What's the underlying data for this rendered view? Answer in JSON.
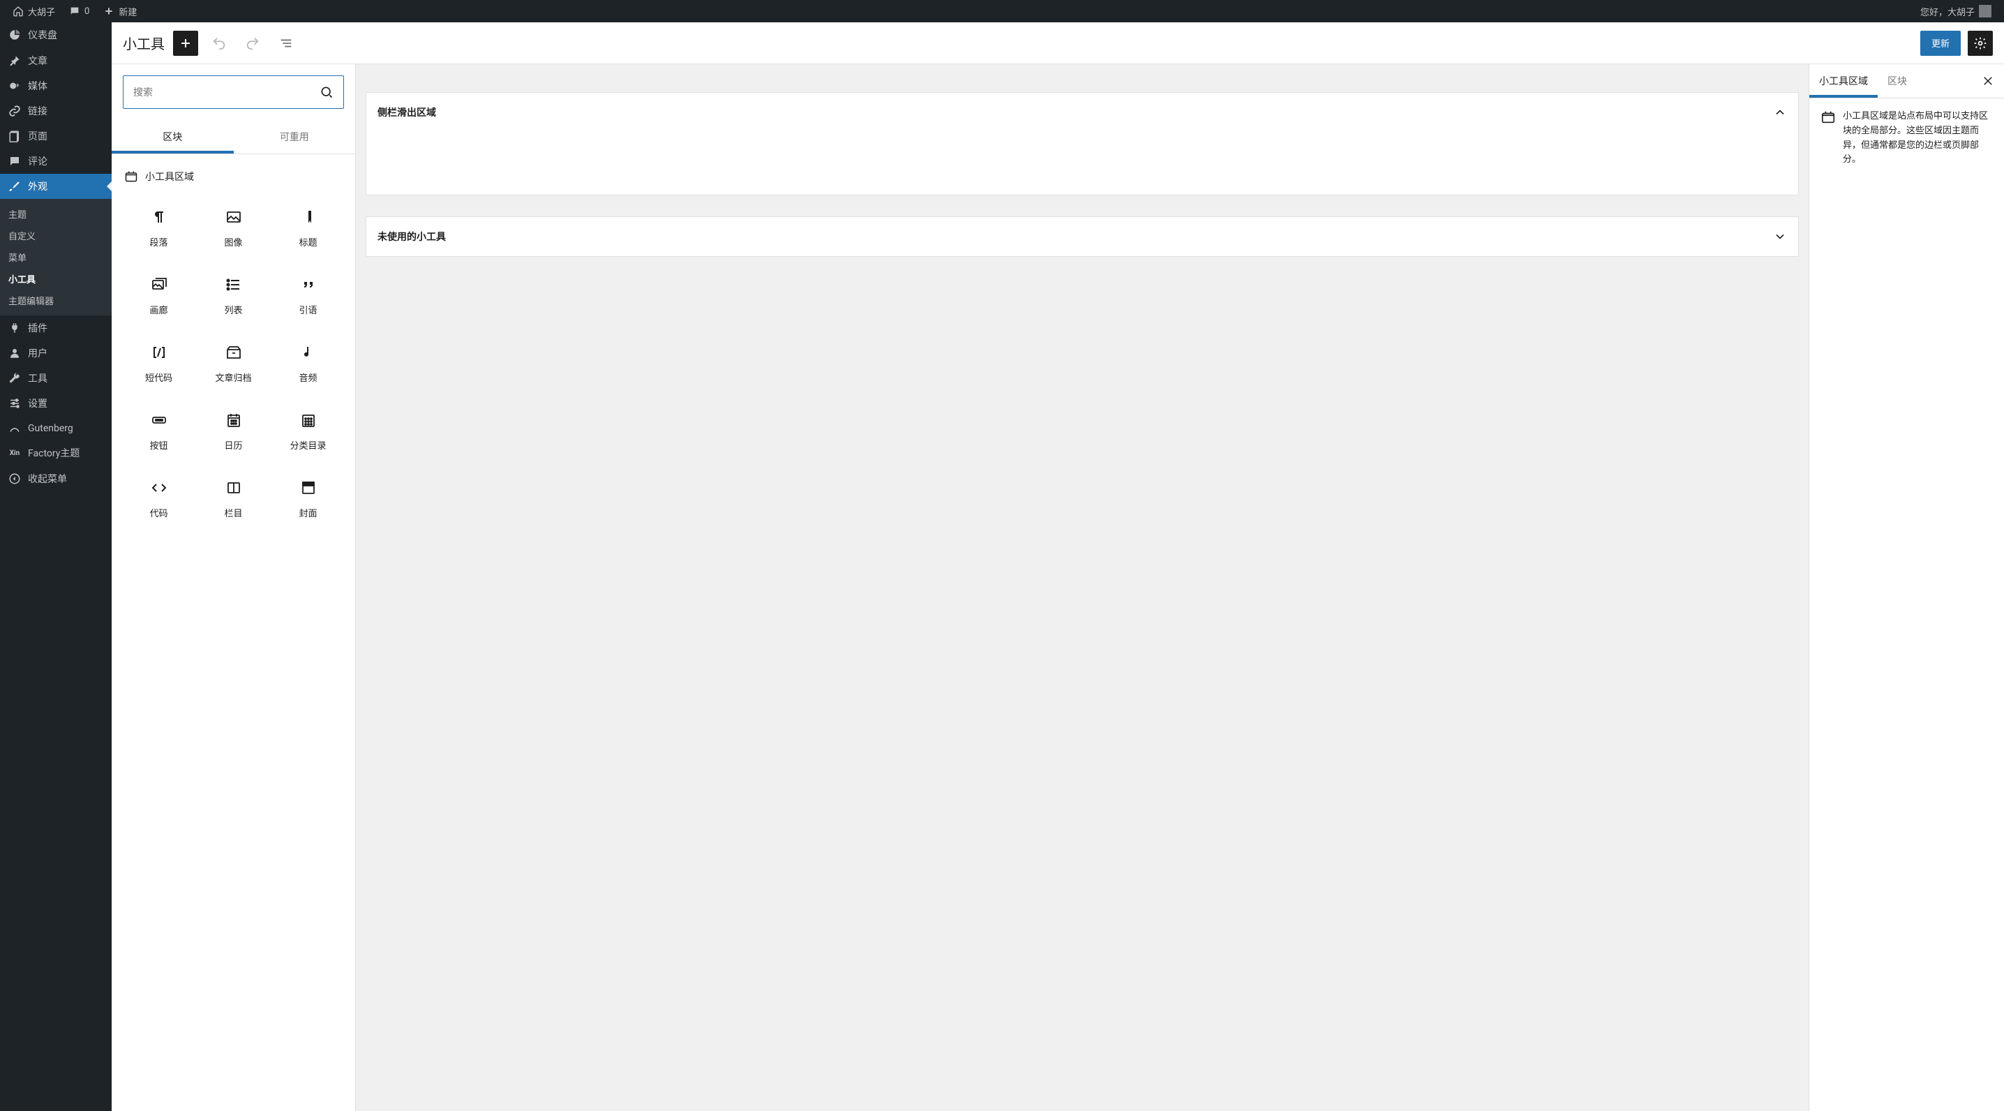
{
  "adminbar": {
    "site_name": "大胡子",
    "comments_count": "0",
    "new_label": "新建",
    "greeting": "您好，大胡子"
  },
  "sidebar": {
    "items": [
      {
        "id": "dashboard",
        "label": "仪表盘",
        "icon": "dashboard"
      },
      {
        "id": "posts",
        "label": "文章",
        "icon": "pin"
      },
      {
        "id": "media",
        "label": "媒体",
        "icon": "media"
      },
      {
        "id": "links",
        "label": "链接",
        "icon": "link"
      },
      {
        "id": "pages",
        "label": "页面",
        "icon": "page"
      },
      {
        "id": "comments",
        "label": "评论",
        "icon": "comment"
      },
      {
        "id": "appearance",
        "label": "外观",
        "icon": "brush"
      },
      {
        "id": "plugins",
        "label": "插件",
        "icon": "plug"
      },
      {
        "id": "users",
        "label": "用户",
        "icon": "user"
      },
      {
        "id": "tools",
        "label": "工具",
        "icon": "wrench"
      },
      {
        "id": "settings",
        "label": "设置",
        "icon": "sliders"
      },
      {
        "id": "gutenberg",
        "label": "Gutenberg",
        "icon": "gutenberg"
      },
      {
        "id": "factory",
        "label": "Factory主题",
        "icon": "xin"
      },
      {
        "id": "collapse",
        "label": "收起菜单",
        "icon": "collapse"
      }
    ],
    "appearance_sub": [
      {
        "id": "themes",
        "label": "主题"
      },
      {
        "id": "customize",
        "label": "自定义"
      },
      {
        "id": "menus",
        "label": "菜单"
      },
      {
        "id": "widgets",
        "label": "小工具"
      },
      {
        "id": "editor",
        "label": "主题编辑器"
      }
    ]
  },
  "header": {
    "title": "小工具",
    "update_label": "更新"
  },
  "inserter": {
    "search_placeholder": "搜索",
    "tabs": {
      "blocks": "区块",
      "reusable": "可重用"
    },
    "section_label": "小工具区域",
    "blocks": [
      {
        "id": "paragraph",
        "label": "段落"
      },
      {
        "id": "image",
        "label": "图像"
      },
      {
        "id": "heading",
        "label": "标题"
      },
      {
        "id": "gallery",
        "label": "画廊"
      },
      {
        "id": "list",
        "label": "列表"
      },
      {
        "id": "quote",
        "label": "引语"
      },
      {
        "id": "shortcode",
        "label": "短代码"
      },
      {
        "id": "archives",
        "label": "文章归档"
      },
      {
        "id": "audio",
        "label": "音频"
      },
      {
        "id": "button",
        "label": "按钮"
      },
      {
        "id": "calendar",
        "label": "日历"
      },
      {
        "id": "categories",
        "label": "分类目录"
      },
      {
        "id": "code",
        "label": "代码"
      },
      {
        "id": "columns",
        "label": "栏目"
      },
      {
        "id": "cover",
        "label": "封面"
      }
    ]
  },
  "canvas": {
    "areas": [
      {
        "id": "slideout",
        "label": "侧栏滑出区域",
        "expanded": true
      },
      {
        "id": "unused",
        "label": "未使用的小工具",
        "expanded": false
      }
    ]
  },
  "settings": {
    "tabs": {
      "area": "小工具区域",
      "block": "区块"
    },
    "description": "小工具区域是站点布局中可以支持区块的全局部分。这些区域因主题而异，但通常都是您的边栏或页脚部分。"
  }
}
